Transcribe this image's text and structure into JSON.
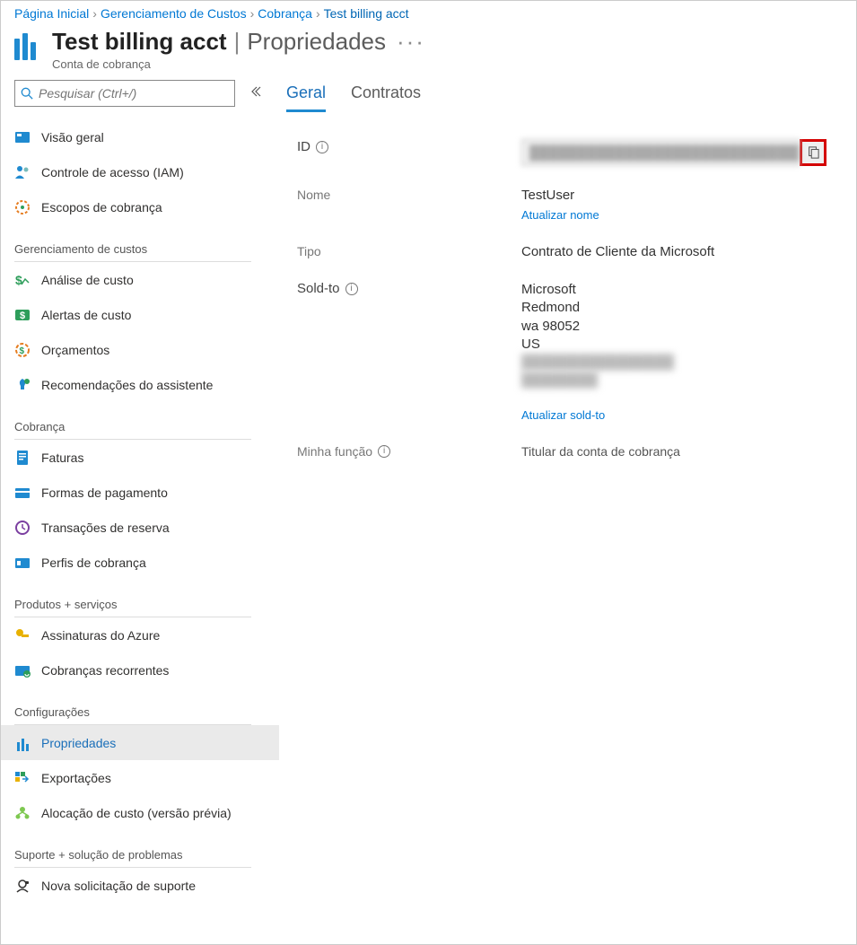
{
  "breadcrumb": {
    "items": [
      "Página Inicial",
      "Gerenciamento de Custos",
      "Cobrança",
      "Test billing acct"
    ]
  },
  "header": {
    "title": "Test billing acct",
    "page": "Propriedades",
    "subtitle": "Conta de cobrança"
  },
  "search": {
    "placeholder": "Pesquisar (Ctrl+/)"
  },
  "sidebar": {
    "top": [
      {
        "label": "Visão geral",
        "icon": "overview"
      },
      {
        "label": "Controle de acesso (IAM)",
        "icon": "people"
      },
      {
        "label": "Escopos de cobrança",
        "icon": "scope"
      }
    ],
    "groups": [
      {
        "title": "Gerenciamento de custos",
        "items": [
          {
            "label": "Análise de custo",
            "icon": "cost-analysis"
          },
          {
            "label": "Alertas de custo",
            "icon": "cost-alert"
          },
          {
            "label": "Orçamentos",
            "icon": "budget"
          },
          {
            "label": "Recomendações do assistente",
            "icon": "advisor"
          }
        ]
      },
      {
        "title": "Cobrança",
        "items": [
          {
            "label": "Faturas",
            "icon": "invoice"
          },
          {
            "label": "Formas de pagamento",
            "icon": "card"
          },
          {
            "label": "Transações de reserva",
            "icon": "clock"
          },
          {
            "label": "Perfis de cobrança",
            "icon": "profile"
          }
        ]
      },
      {
        "title": "Produtos +   serviços",
        "items": [
          {
            "label": "Assinaturas do Azure",
            "icon": "key"
          },
          {
            "label": "Cobranças recorrentes",
            "icon": "recurring"
          }
        ]
      },
      {
        "title": "Configurações",
        "items": [
          {
            "label": "Propriedades",
            "icon": "properties",
            "selected": true
          },
          {
            "label": "Exportações",
            "icon": "export"
          },
          {
            "label": "Alocação de custo (versão prévia)",
            "icon": "allocation"
          }
        ]
      },
      {
        "title": "Suporte +   solução de problemas",
        "items": [
          {
            "label": "Nova solicitação de suporte",
            "icon": "support"
          }
        ]
      }
    ]
  },
  "tabs": {
    "active": "Geral",
    "other": "Contratos"
  },
  "fields": {
    "id_label": "ID",
    "id_value": "████████████████████████████████ ...",
    "name_label": "Nome",
    "name_value": "TestUser",
    "name_link": "Atualizar nome",
    "type_label": "Tipo",
    "type_value": "Contrato de Cliente da Microsoft",
    "soldto_label": "Sold-to",
    "soldto_lines": [
      "Microsoft",
      "Redmond",
      "wa 98052",
      "US"
    ],
    "soldto_blur1": "████████████████",
    "soldto_blur2": "████████",
    "soldto_link": "Atualizar sold-to",
    "role_label": "Minha função",
    "role_value": "Titular da conta de cobrança"
  }
}
